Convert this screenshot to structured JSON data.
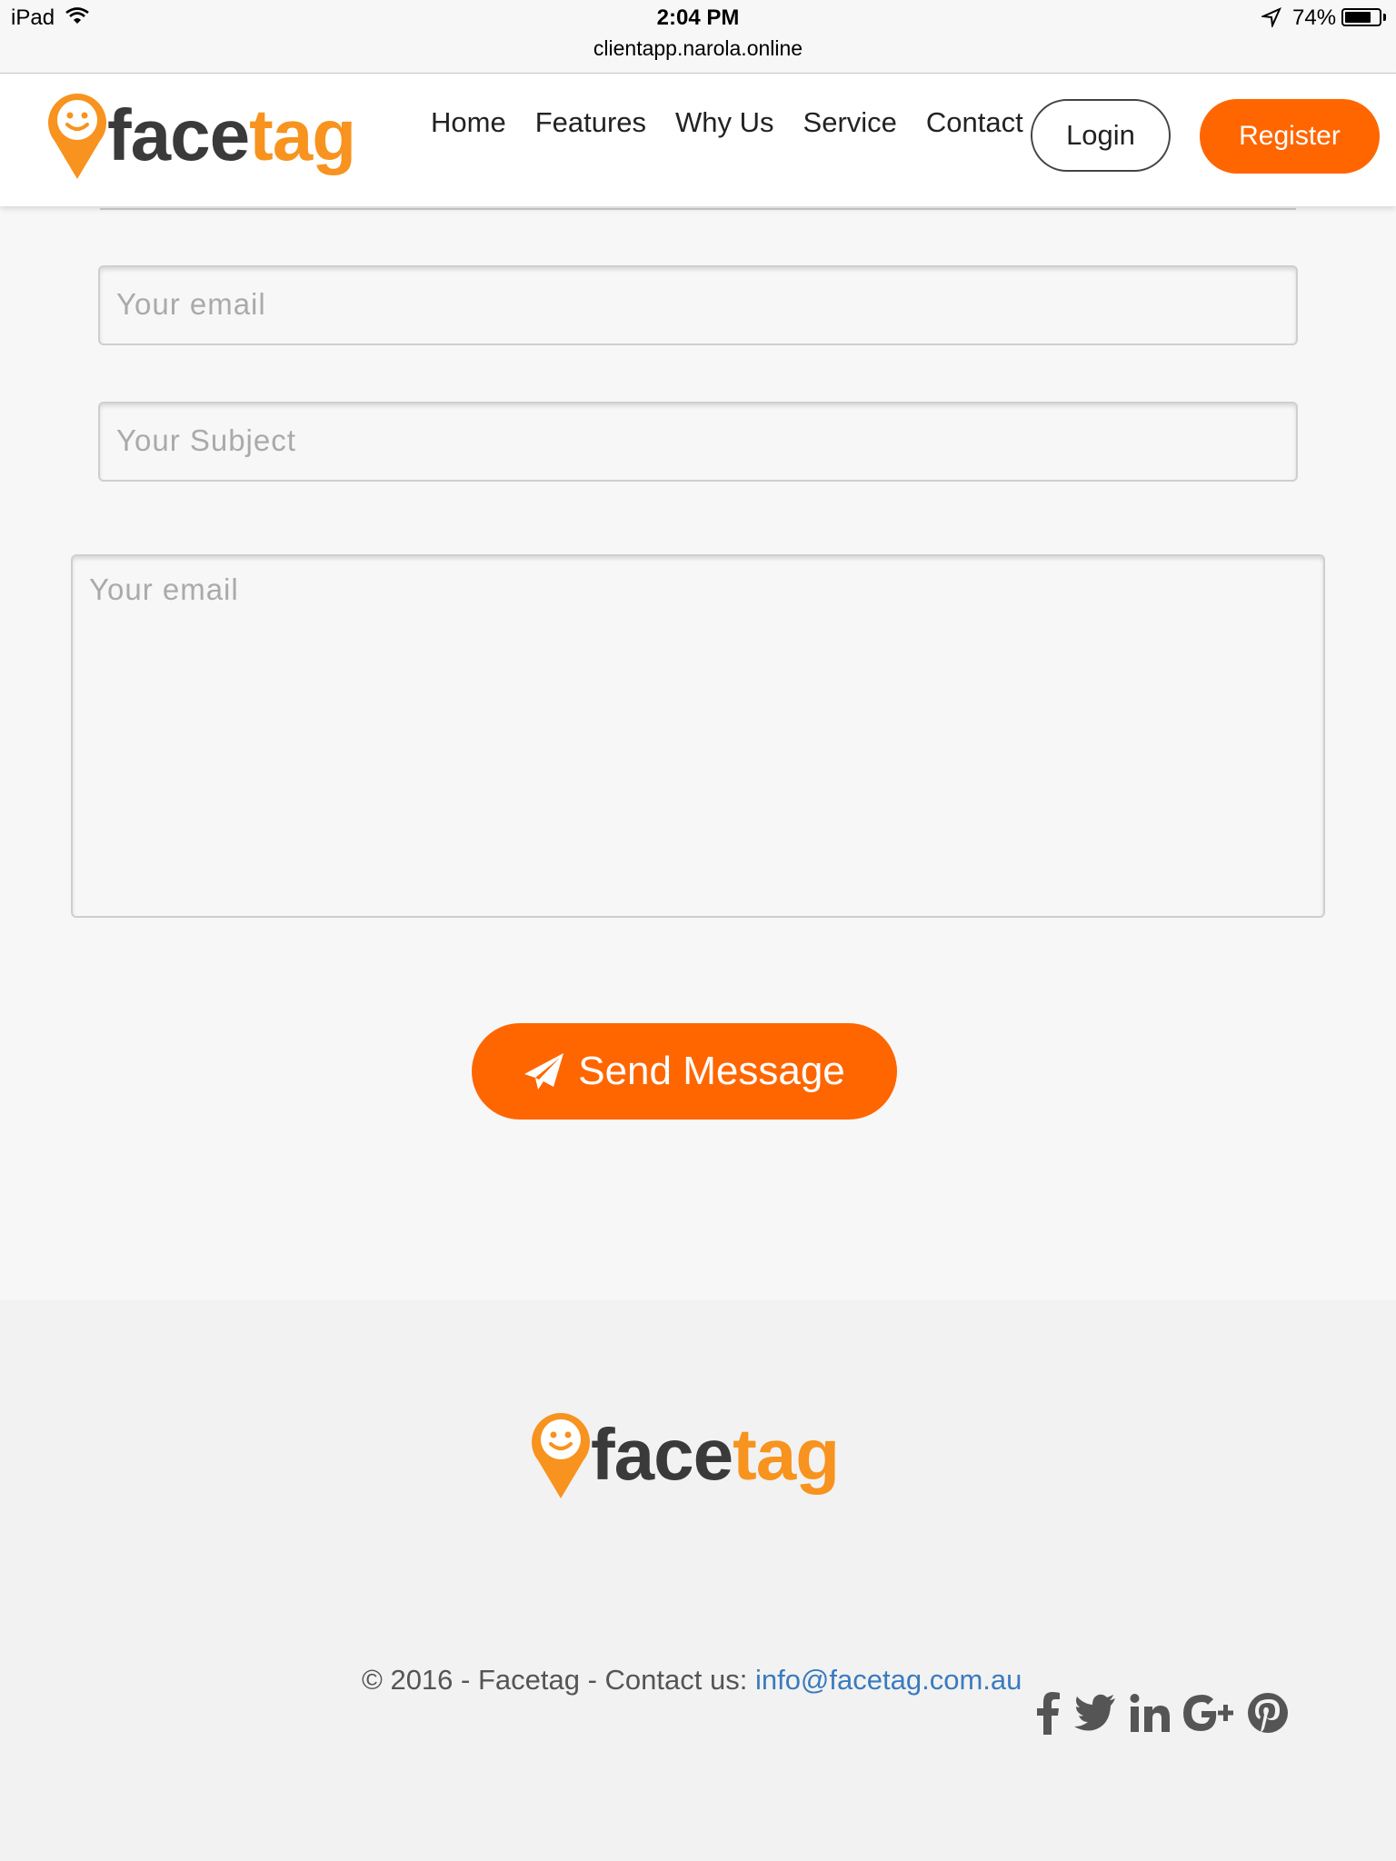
{
  "status_bar": {
    "device": "iPad",
    "time": "2:04 PM",
    "url": "clientapp.narola.online",
    "battery": "74%"
  },
  "brand": {
    "logo_face": "face",
    "logo_tag": "tag",
    "accent_color": "#ff6600",
    "logo_orange": "#f7931e"
  },
  "nav": {
    "items": [
      "Home",
      "Features",
      "Why Us",
      "Service",
      "Contact"
    ],
    "login_label": "Login",
    "register_label": "Register"
  },
  "form": {
    "email_placeholder": "Your email",
    "subject_placeholder": "Your Subject",
    "message_placeholder": "Your email",
    "send_label": "Send Message",
    "send_icon": "paper-plane-icon"
  },
  "footer": {
    "copyright": "© 2016 - Facetag - Contact us: ",
    "email_link": "info@facetag.com.au",
    "social_icons": [
      "facebook-icon",
      "twitter-icon",
      "linkedin-icon",
      "google-plus-icon",
      "pinterest-icon"
    ],
    "link_color": "#3a7bbf"
  }
}
